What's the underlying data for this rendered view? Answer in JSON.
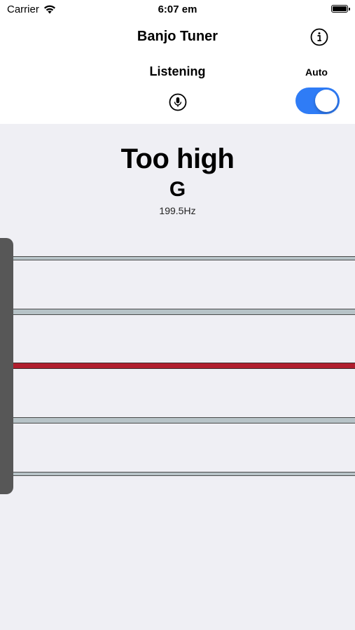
{
  "status_bar": {
    "carrier": "Carrier",
    "time": "6:07 em"
  },
  "nav": {
    "title": "Banjo Tuner",
    "info_icon": "info-circle-icon"
  },
  "controls": {
    "listening_label": "Listening",
    "mic_icon": "microphone-icon",
    "auto_label": "Auto",
    "auto_enabled": true
  },
  "colors": {
    "accent": "#2f7cf6",
    "active_string": "#b01e2e",
    "string": "#b7c3c7",
    "nut": "#575757"
  },
  "tuner": {
    "status": "Too high",
    "note": "G",
    "frequency": "199.5Hz"
  },
  "strings": [
    {
      "string": 1,
      "active": false
    },
    {
      "string": 2,
      "active": false
    },
    {
      "string": 3,
      "active": true
    },
    {
      "string": 4,
      "active": false
    },
    {
      "string": 5,
      "active": false
    }
  ]
}
